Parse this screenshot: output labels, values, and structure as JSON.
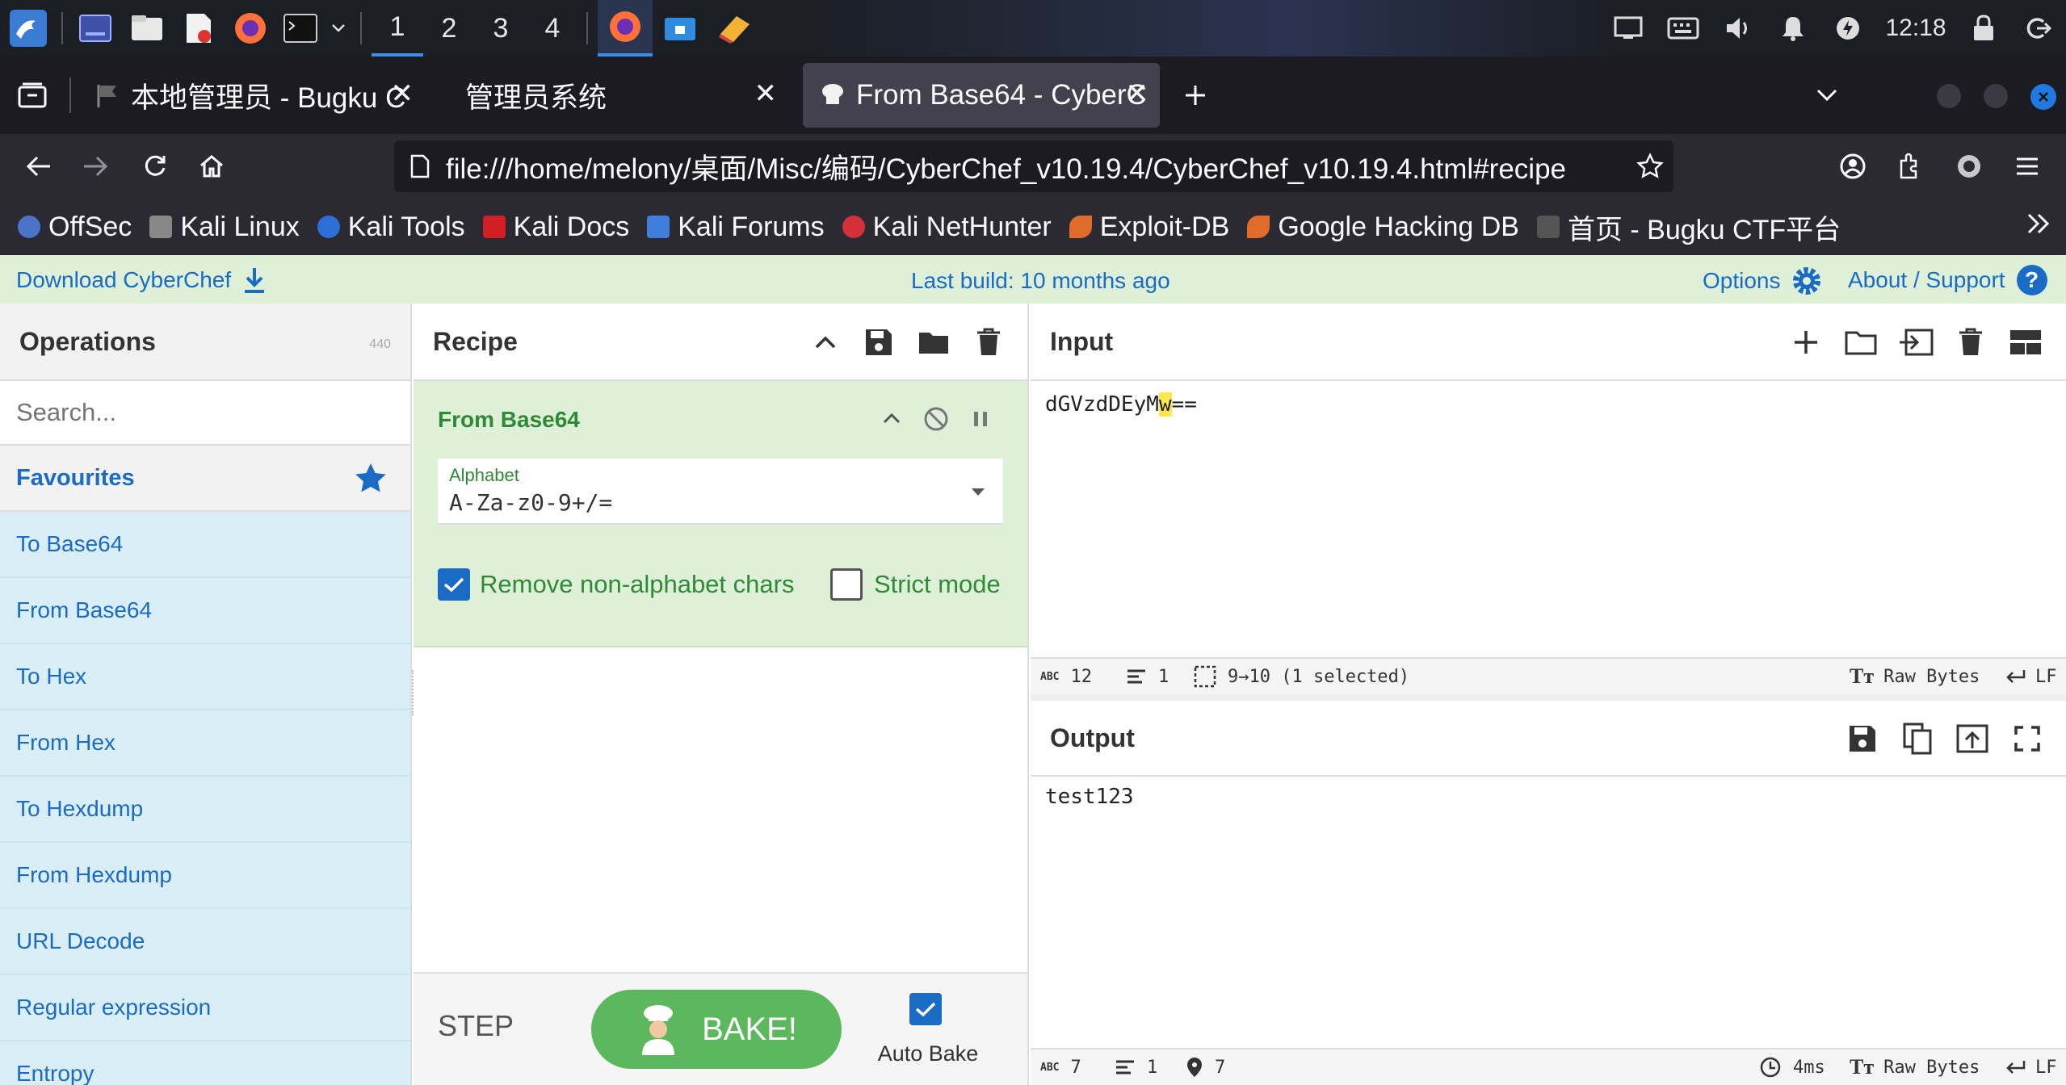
{
  "taskbar": {
    "workspaces": [
      "1",
      "2",
      "3",
      "4"
    ],
    "clock": "12:18"
  },
  "tabs": [
    {
      "title": "本地管理员 - Bugku C"
    },
    {
      "title": "管理员系统"
    },
    {
      "title": "From Base64 - CyberC"
    }
  ],
  "navbar": {
    "url": "file:///home/melony/桌面/Misc/编码/CyberChef_v10.19.4/CyberChef_v10.19.4.html#recipe"
  },
  "bookmarks": [
    {
      "label": "OffSec",
      "color": "#4a73c9"
    },
    {
      "label": "Kali Linux",
      "color": "#5b7bd4"
    },
    {
      "label": "Kali Tools",
      "color": "#2d6fd8"
    },
    {
      "label": "Kali Docs",
      "color": "#d21f26"
    },
    {
      "label": "Kali Forums",
      "color": "#3f7fdb"
    },
    {
      "label": "Kali NetHunter",
      "color": "#d3303b"
    },
    {
      "label": "Exploit-DB",
      "color": "#e06b2b"
    },
    {
      "label": "Google Hacking DB",
      "color": "#e06b2b"
    },
    {
      "label": "首页 - Bugku CTF平台",
      "color": "#555555"
    }
  ],
  "banner": {
    "download": "Download CyberChef",
    "build": "Last build: 10 months ago",
    "options": "Options",
    "about": "About / Support"
  },
  "operations": {
    "title": "Operations",
    "count": "440",
    "search_placeholder": "Search...",
    "favourites": "Favourites",
    "items": [
      "To Base64",
      "From Base64",
      "To Hex",
      "From Hex",
      "To Hexdump",
      "From Hexdump",
      "URL Decode",
      "Regular expression",
      "Entropy"
    ]
  },
  "recipe": {
    "title": "Recipe",
    "operation": {
      "name": "From Base64",
      "alphabet_label": "Alphabet",
      "alphabet_value": "A-Za-z0-9+/=",
      "remove_label": "Remove non-alphabet chars",
      "strict_label": "Strict mode",
      "remove_checked": true,
      "strict_checked": false
    },
    "step": "STEP",
    "bake": "BAKE!",
    "autobake": "Auto Bake",
    "autobake_checked": true
  },
  "input": {
    "title": "Input",
    "text_before": "dGVzdDEyM",
    "text_selected": "w",
    "text_after": "==",
    "status": {
      "chars": "12",
      "lines": "1",
      "selection": "9→10 (1 selected)",
      "encoding": "Raw Bytes",
      "eol": "LF"
    }
  },
  "output": {
    "title": "Output",
    "text": "test123",
    "status": {
      "chars": "7",
      "lines": "1",
      "position": "7",
      "time": "4ms",
      "encoding": "Raw Bytes",
      "eol": "LF"
    }
  },
  "colors": {
    "accent_blue": "#1a6bc4",
    "green": "#2f8a37",
    "bake_green": "#5cb85c",
    "banner_green": "#dff0d8"
  }
}
